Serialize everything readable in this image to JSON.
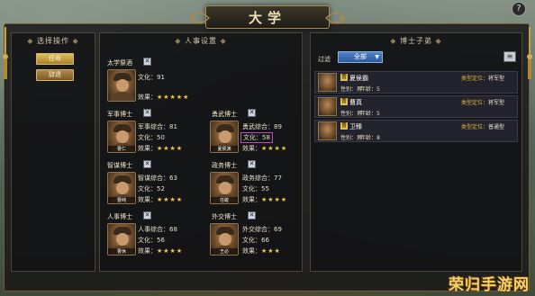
{
  "window": {
    "title": "大学",
    "help_label": "?"
  },
  "left_panel": {
    "header": "选择操作",
    "buttons": [
      {
        "label": "任命",
        "active": true
      },
      {
        "label": "辞退",
        "active": false
      }
    ]
  },
  "middle_panel": {
    "header": "人事设置",
    "x_label": "✕",
    "stars_label": "效果：",
    "headmaster": {
      "title": "太学祭酒",
      "stat_name": "文化",
      "stat_value": "91",
      "stars": "★★★★★",
      "star_count": 5
    },
    "slots": [
      {
        "title": "军事博士",
        "stat_name": "军事综合",
        "stat_value": "81",
        "culture": "50",
        "stars": "★★★★",
        "star_count": 4,
        "portrait_name": "曹仁"
      },
      {
        "title": "勇武博士",
        "stat_name": "勇武综合",
        "stat_value": "89",
        "culture": "58",
        "stars": "★★★★",
        "star_count": 4,
        "portrait_name": "夏侯渊"
      },
      {
        "title": "智谋博士",
        "stat_name": "智谋综合",
        "stat_value": "63",
        "culture": "52",
        "stars": "★★★★",
        "star_count": 4,
        "portrait_name": "曹纯"
      },
      {
        "title": "政务博士",
        "stat_name": "政务综合",
        "stat_value": "77",
        "culture": "55",
        "stars": "★★★★",
        "star_count": 4,
        "portrait_name": "任峻"
      },
      {
        "title": "人事博士",
        "stat_name": "人事综合",
        "stat_value": "68",
        "culture": "56",
        "stars": "★★★★",
        "star_count": 4,
        "portrait_name": "曹休"
      },
      {
        "title": "外交博士",
        "stat_name": "外交综合",
        "stat_value": "69",
        "culture": "66",
        "stars": "★★★",
        "star_count": 3,
        "portrait_name": "王必"
      }
    ],
    "culture_label": "文化："
  },
  "right_panel": {
    "header": "博士子弟",
    "filter_label": "过滤",
    "filter_value": "全部",
    "rows": [
      {
        "badge": "曹",
        "name": "夏侯霸",
        "type_label": "类型定位：",
        "type_value": "将军型",
        "sex_label": "性别：",
        "sex": "男",
        "age_label": "年龄：",
        "age": "5"
      },
      {
        "badge": "曹",
        "name": "曹真",
        "type_label": "类型定位：",
        "type_value": "将军型",
        "sex_label": "性别：",
        "sex": "男",
        "age_label": "年龄：",
        "age": "5"
      },
      {
        "badge": "曹",
        "name": "卫臻",
        "type_label": "类型定位：",
        "type_value": "普通型",
        "sex_label": "性别：",
        "sex": "男",
        "age_label": "年龄：",
        "age": "8"
      }
    ]
  },
  "watermark": "荣归手游网",
  "colors": {
    "accent_gold": "#a68a52",
    "star": "#f2c84a",
    "filter_blue": "#2d5a9c"
  }
}
